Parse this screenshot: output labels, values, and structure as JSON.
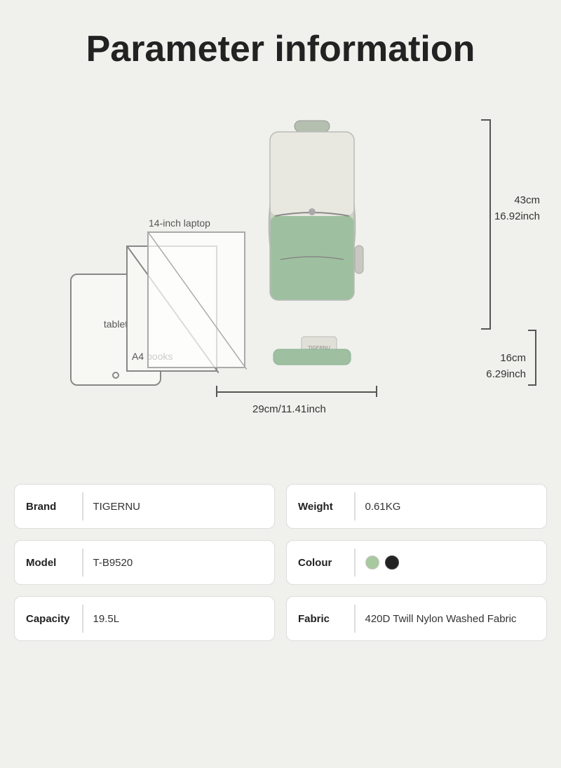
{
  "page": {
    "title": "Parameter information",
    "background": "#f0f0ec"
  },
  "diagram": {
    "items": [
      {
        "id": "tablet",
        "label": "tablet"
      },
      {
        "id": "a4",
        "label": "A4 books"
      },
      {
        "id": "laptop",
        "label": "14-inch laptop"
      }
    ],
    "measurements": {
      "height_cm": "43cm",
      "height_inch": "16.92inch",
      "width_cm": "29cm/11.41inch",
      "depth_cm": "16cm",
      "depth_inch": "6.29inch"
    }
  },
  "params": {
    "left": [
      {
        "key": "Brand",
        "value": "TIGERNU"
      },
      {
        "key": "Model",
        "value": "T-B9520"
      },
      {
        "key": "Capacity",
        "value": "19.5L"
      }
    ],
    "right": [
      {
        "key": "Weight",
        "value": "0.61KG"
      },
      {
        "key": "Colour",
        "value": "colour_dots"
      },
      {
        "key": "Fabric",
        "value": "420D Twill Nylon Washed Fabric"
      }
    ],
    "colours": [
      {
        "name": "light-green",
        "hex": "#a8c8a0"
      },
      {
        "name": "black",
        "hex": "#222222"
      }
    ]
  }
}
